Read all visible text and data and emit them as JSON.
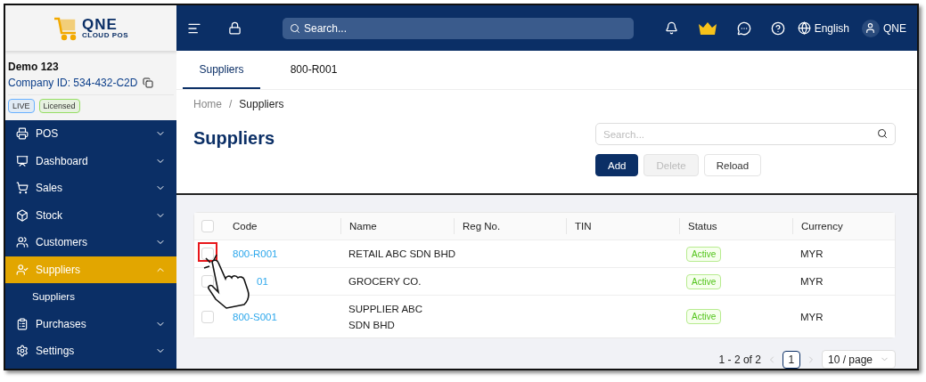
{
  "logo": {
    "name": "QNE",
    "tagline": "CLOUD POS"
  },
  "company": {
    "name": "Demo 123",
    "id_label": "Company ID: 534-432-C2D",
    "badges": [
      {
        "label": "LIVE",
        "color": "#69b1ff"
      },
      {
        "label": "Licensed",
        "color": "#95de64"
      }
    ]
  },
  "sidebar": {
    "items": [
      {
        "label": "POS",
        "expanded": false,
        "selected": false
      },
      {
        "label": "Dashboard",
        "expanded": false,
        "selected": false
      },
      {
        "label": "Sales",
        "expanded": false,
        "selected": false
      },
      {
        "label": "Stock",
        "expanded": false,
        "selected": false
      },
      {
        "label": "Customers",
        "expanded": false,
        "selected": false
      },
      {
        "label": "Suppliers",
        "expanded": true,
        "selected": true,
        "children": [
          {
            "label": "Suppliers"
          }
        ]
      },
      {
        "label": "Purchases",
        "expanded": false,
        "selected": false
      },
      {
        "label": "Settings",
        "expanded": false,
        "selected": false
      }
    ]
  },
  "header": {
    "search_placeholder": "Search...",
    "language": "English",
    "user": "QNE"
  },
  "tabs": [
    {
      "label": "Suppliers",
      "selected": true
    },
    {
      "label": "800-R001",
      "selected": false
    }
  ],
  "breadcrumb": [
    "Home",
    "Suppliers"
  ],
  "breadcrumb_separator": "/",
  "page": {
    "title": "Suppliers",
    "search_placeholder": "Search...",
    "buttons": [
      {
        "label": "Add",
        "kind": "primary"
      },
      {
        "label": "Delete",
        "kind": "disabled"
      },
      {
        "label": "Reload",
        "kind": "default"
      }
    ]
  },
  "table": {
    "select_all_checked": false,
    "columns": [
      "Code",
      "Name",
      "Reg No.",
      "TIN",
      "Status",
      "Currency"
    ],
    "rows": [
      {
        "code": "800-R001",
        "name": "RETAIL ABC SDN BHD",
        "status": "Active",
        "currency": "MYR",
        "highlighted": true,
        "checked": false,
        "code_hidden": false
      },
      {
        "code": "01",
        "name": "GROCERY CO.",
        "status": "Active",
        "currency": "MYR",
        "highlighted": false,
        "checked": false,
        "code_hidden": true
      },
      {
        "code": "800-S001",
        "name": "SUPPLIER ABC SDN BHD",
        "status": "Active",
        "currency": "MYR",
        "highlighted": false,
        "checked": false,
        "code_hidden": false
      }
    ]
  },
  "pagination": {
    "summary": "1 - 2 of 2",
    "pages": [
      {
        "label": "1",
        "selected": true
      }
    ],
    "page_size": "10 / page"
  }
}
